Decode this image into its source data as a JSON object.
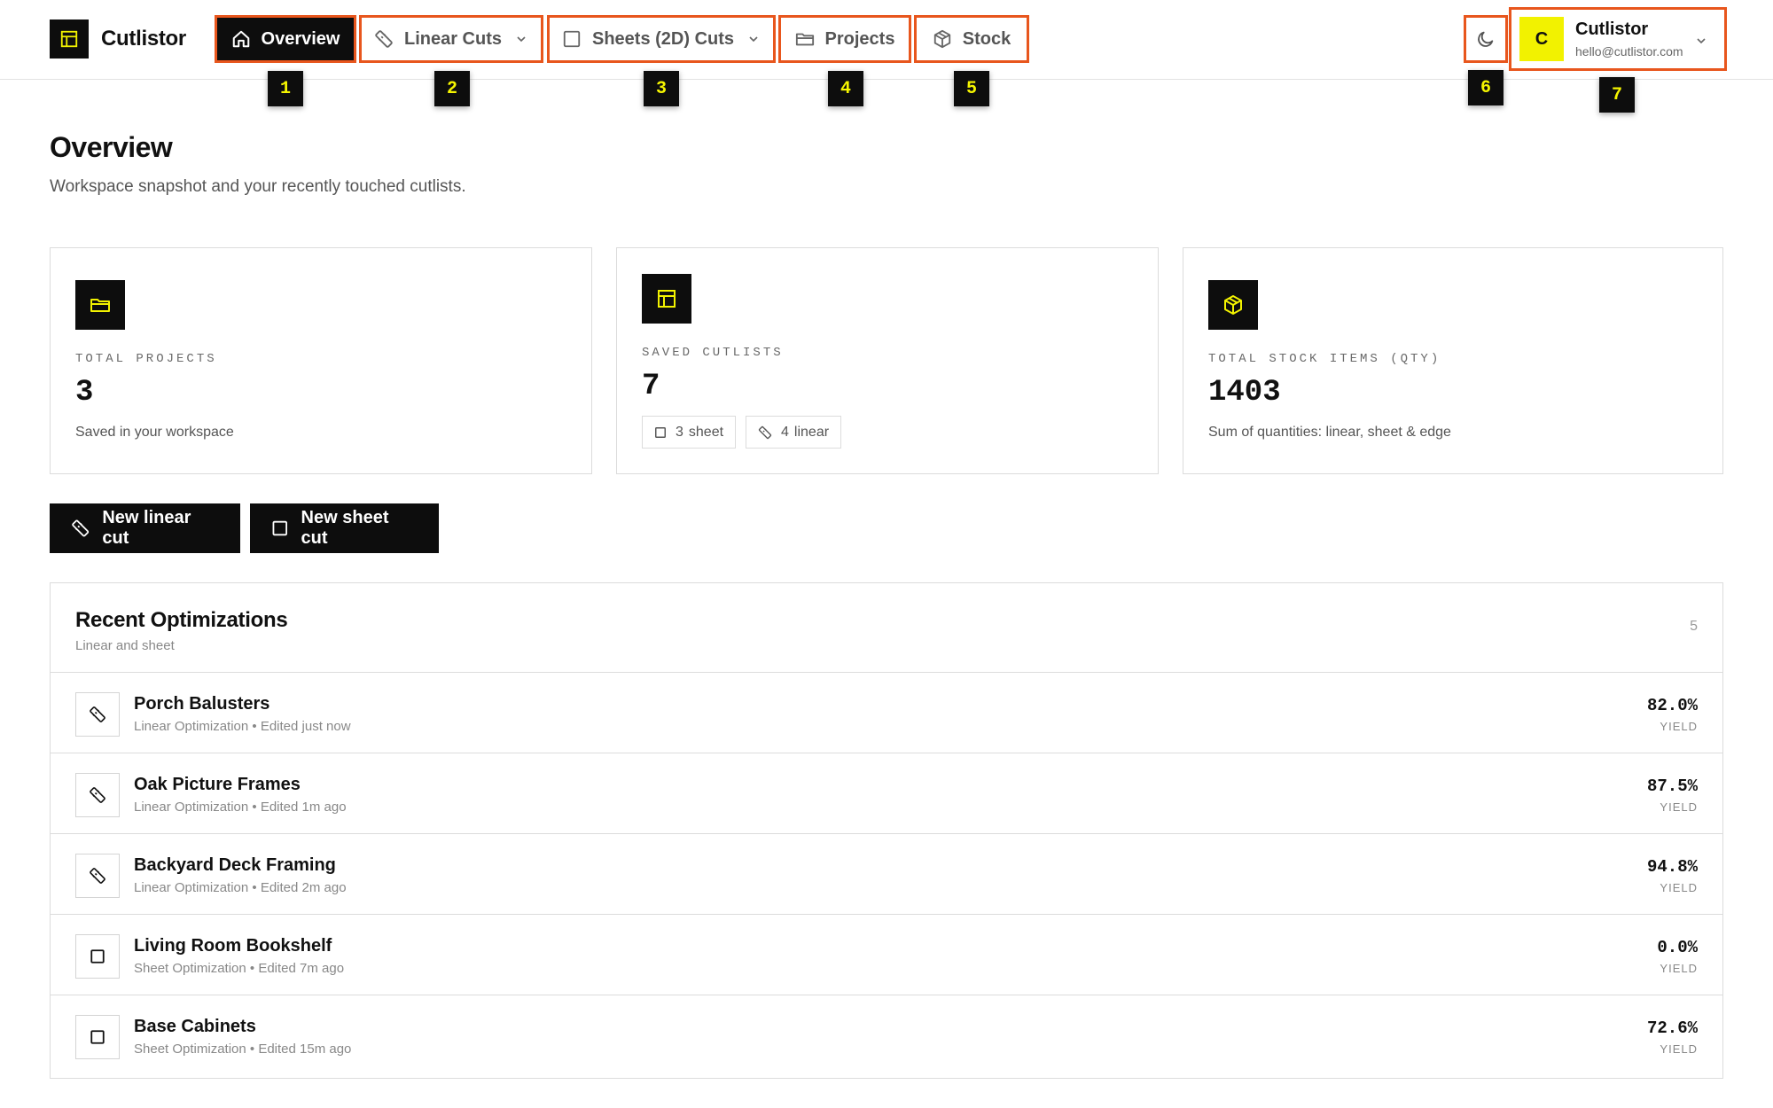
{
  "app": {
    "name": "Cutlistor"
  },
  "nav": {
    "items": [
      {
        "id": "overview",
        "label": "Overview",
        "icon": "home-icon",
        "active": true,
        "dropdown": false,
        "badge": "1"
      },
      {
        "id": "linear",
        "label": "Linear Cuts",
        "icon": "ruler-icon",
        "active": false,
        "dropdown": true,
        "badge": "2"
      },
      {
        "id": "sheets",
        "label": "Sheets (2D) Cuts",
        "icon": "square-icon",
        "active": false,
        "dropdown": true,
        "badge": "3"
      },
      {
        "id": "projects",
        "label": "Projects",
        "icon": "folder-icon",
        "active": false,
        "dropdown": false,
        "badge": "4"
      },
      {
        "id": "stock",
        "label": "Stock",
        "icon": "box-icon",
        "active": false,
        "dropdown": false,
        "badge": "5"
      }
    ],
    "theme_badge": "6",
    "user_badge": "7"
  },
  "user": {
    "initial": "C",
    "name": "Cutlistor",
    "email": "hello@cutlistor.com"
  },
  "page": {
    "title": "Overview",
    "subtitle": "Workspace snapshot and your recently touched cutlists."
  },
  "stats": {
    "projects": {
      "label": "TOTAL PROJECTS",
      "value": "3",
      "note": "Saved in your workspace",
      "icon": "folder-icon"
    },
    "cutlists": {
      "label": "SAVED CUTLISTS",
      "value": "7",
      "icon": "layout-icon",
      "sheet_count": "3",
      "sheet_label": "sheet",
      "linear_count": "4",
      "linear_label": "linear"
    },
    "stock": {
      "label": "TOTAL STOCK ITEMS (QTY)",
      "value": "1403",
      "note": "Sum of quantities: linear, sheet & edge",
      "icon": "box-icon"
    }
  },
  "actions": {
    "new_linear": "New linear cut",
    "new_sheet": "New sheet cut"
  },
  "recent": {
    "title": "Recent Optimizations",
    "subtitle": "Linear and sheet",
    "count": "5",
    "yield_label": "YIELD",
    "rows": [
      {
        "name": "Porch Balusters",
        "meta": "Linear Optimization • Edited just now",
        "yield": "82.0%",
        "icon": "ruler-icon"
      },
      {
        "name": "Oak Picture Frames",
        "meta": "Linear Optimization • Edited 1m ago",
        "yield": "87.5%",
        "icon": "ruler-icon"
      },
      {
        "name": "Backyard Deck Framing",
        "meta": "Linear Optimization • Edited 2m ago",
        "yield": "94.8%",
        "icon": "ruler-icon"
      },
      {
        "name": "Living Room Bookshelf",
        "meta": "Sheet Optimization • Edited 7m ago",
        "yield": "0.0%",
        "icon": "square-icon"
      },
      {
        "name": "Base Cabinets",
        "meta": "Sheet Optimization • Edited 15m ago",
        "yield": "72.6%",
        "icon": "square-icon"
      }
    ]
  },
  "colors": {
    "accent_yellow": "#f2f200",
    "highlight_orange": "#e8561d",
    "dark": "#0d0d0d"
  }
}
